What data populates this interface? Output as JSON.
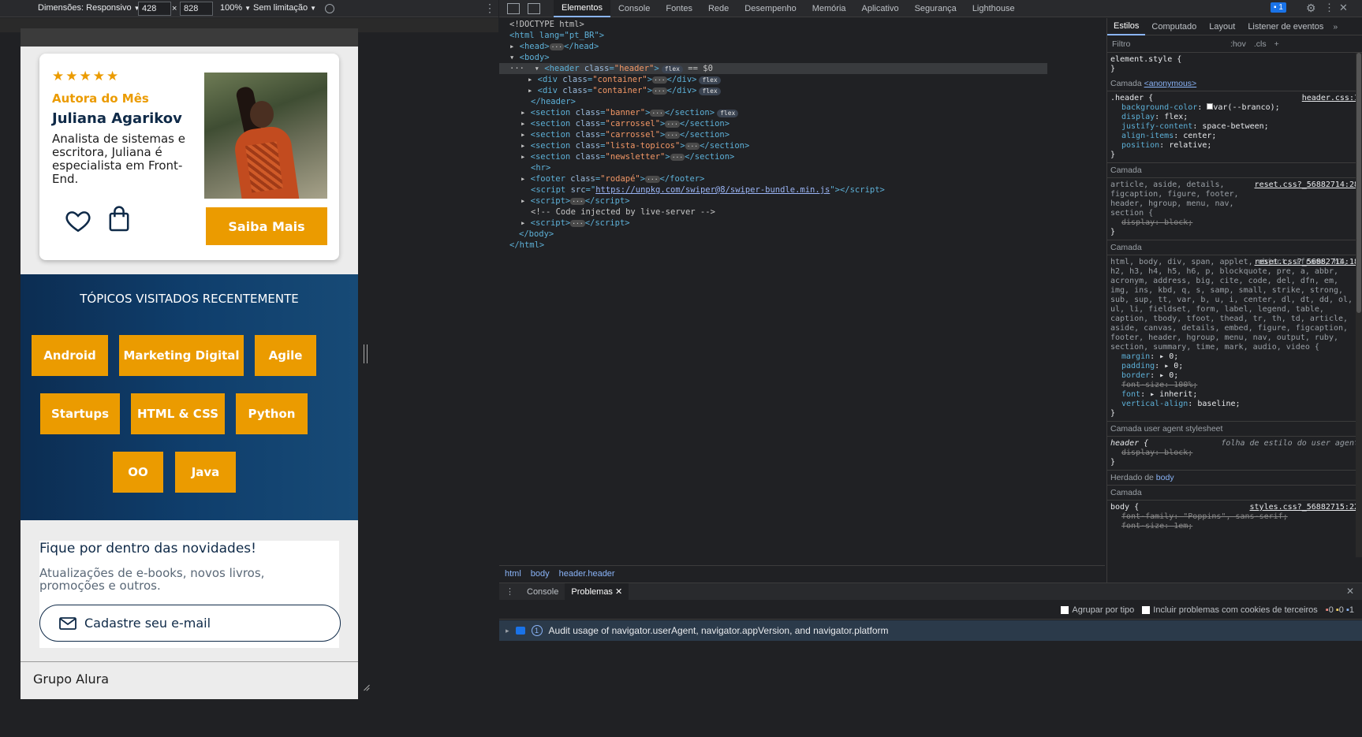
{
  "device_toolbar": {
    "dimensions_label": "Dimensões: Responsivo",
    "width": "428",
    "height": "828",
    "times": "×",
    "zoom": "100%",
    "throttle": "Sem limitação"
  },
  "page": {
    "card": {
      "stars": "★★★★★",
      "tag": "Autora do Mês",
      "name": "Juliana Agarikov",
      "description": "Analista de sistemas e escritora, Juliana é especialista em Front-End.",
      "button": "Saiba Mais"
    },
    "topics": {
      "title": "TÓPICOS VISITADOS RECENTEMENTE",
      "items": [
        "Android",
        "Marketing Digital",
        "Agile",
        "Startups",
        "HTML & CSS",
        "Python",
        "OO",
        "Java"
      ]
    },
    "newsletter": {
      "title": "Fique por dentro das novidades!",
      "subtitle": "Atualizações de e-books, novos livros, promoções e outros.",
      "button": "Cadastre seu e-mail"
    },
    "footer": "Grupo Alura",
    "colors": {
      "accent": "#eb9b00",
      "navy": "#0f2a48"
    }
  },
  "devtools": {
    "tabs": [
      "Elementos",
      "Console",
      "Fontes",
      "Rede",
      "Desempenho",
      "Memória",
      "Aplicativo",
      "Segurança",
      "Lighthouse"
    ],
    "active_tab": "Elementos",
    "messages_badge": "1",
    "dom": {
      "doctype": "<!DOCTYPE html>",
      "html_open": "<html lang=\"pt_BR\">",
      "head": "<head>",
      "head_close": "</head>",
      "body": "<body>",
      "header_attr": "class",
      "header_val": "\"header\"",
      "selected_marker": "== $0",
      "container": "\"container\"",
      "banner": "\"banner\"",
      "carrossel": "\"carrossel\"",
      "lista": "\"lista-topicos\"",
      "newsletter": "\"newsletter\"",
      "rodape": "\"rodapé\"",
      "script_src": "https://unpkg.com/swiper@8/swiper-bundle.min.js",
      "comment": "<!-- Code injected by live-server -->",
      "flex": "flex"
    },
    "breadcrumb": [
      "html",
      "body",
      "header.header"
    ],
    "drawer_tabs": [
      "Console",
      "Problemas"
    ],
    "issues_toolbar": {
      "group_by_type": "Agrupar por tipo",
      "third_party": "Incluir problemas com cookies de terceiros",
      "counts": [
        "0",
        "0",
        "1"
      ]
    },
    "issue": {
      "count": "1",
      "text": "Audit usage of navigator.userAgent, navigator.appVersion, and navigator.platform"
    },
    "styles": {
      "tabs": [
        "Estilos",
        "Computado",
        "Layout",
        "Listener de eventos"
      ],
      "filter_placeholder": "Filtro",
      "hov": ":hov",
      "cls": ".cls",
      "element_style": "element.style {",
      "layer_label": "Camada",
      "anonymous": "<anonymous>",
      "header_selector": ".header {",
      "header_source": "header.css:1",
      "header_props": [
        {
          "name": "background-color",
          "value": "var(--branco);"
        },
        {
          "name": "display",
          "value": "flex;"
        },
        {
          "name": "justify-content",
          "value": "space-between;"
        },
        {
          "name": "align-items",
          "value": "center;"
        },
        {
          "name": "position",
          "value": "relative;"
        }
      ],
      "reset_source_1": "reset.css?_56882714:28",
      "reset_selector_1": "article, aside, details, figcaption, figure, footer, header, hgroup, menu, nav, section {",
      "reset_prop_1": "display: block;",
      "reset_source_2": "reset.css?_56882714:18",
      "reset_selector_2": "html, body, div, span, applet, object, iframe, h1, h2, h3, h4, h5, h6, p, blockquote, pre, a, abbr, acronym, address, big, cite, code, del, dfn, em, img, ins, kbd, q, s, samp, small, strike, strong, sub, sup, tt, var, b, u, i, center, dl, dt, dd, ol, ul, li, fieldset, form, label, legend, table, caption, tbody, tfoot, thead, tr, th, td, article, aside, canvas, details, embed, figure, figcaption, footer, header, hgroup, menu, nav, output, ruby, section, summary, time, mark, audio, video {",
      "reset_props_2": [
        {
          "name": "margin",
          "value": "▸ 0;",
          "strike": false
        },
        {
          "name": "padding",
          "value": "▸ 0;",
          "strike": false
        },
        {
          "name": "border",
          "value": "▸ 0;",
          "strike": false
        },
        {
          "name": "font-size",
          "value": "100%;",
          "strike": true
        },
        {
          "name": "font",
          "value": "▸ inherit;",
          "strike": false
        },
        {
          "name": "vertical-align",
          "value": "baseline;",
          "strike": false
        }
      ],
      "ua_layer": "Camada user agent stylesheet",
      "ua_selector": "header {",
      "ua_note": "folha de estilo do user agent",
      "ua_prop": "display: block;",
      "inherited_label": "Herdado de",
      "inherited_from": "body",
      "body_selector": "body {",
      "body_source": "styles.css?_56882715:22",
      "body_props": [
        "font-family: \"Poppins\", sans-serif;",
        "font-size: 1em;"
      ]
    }
  }
}
